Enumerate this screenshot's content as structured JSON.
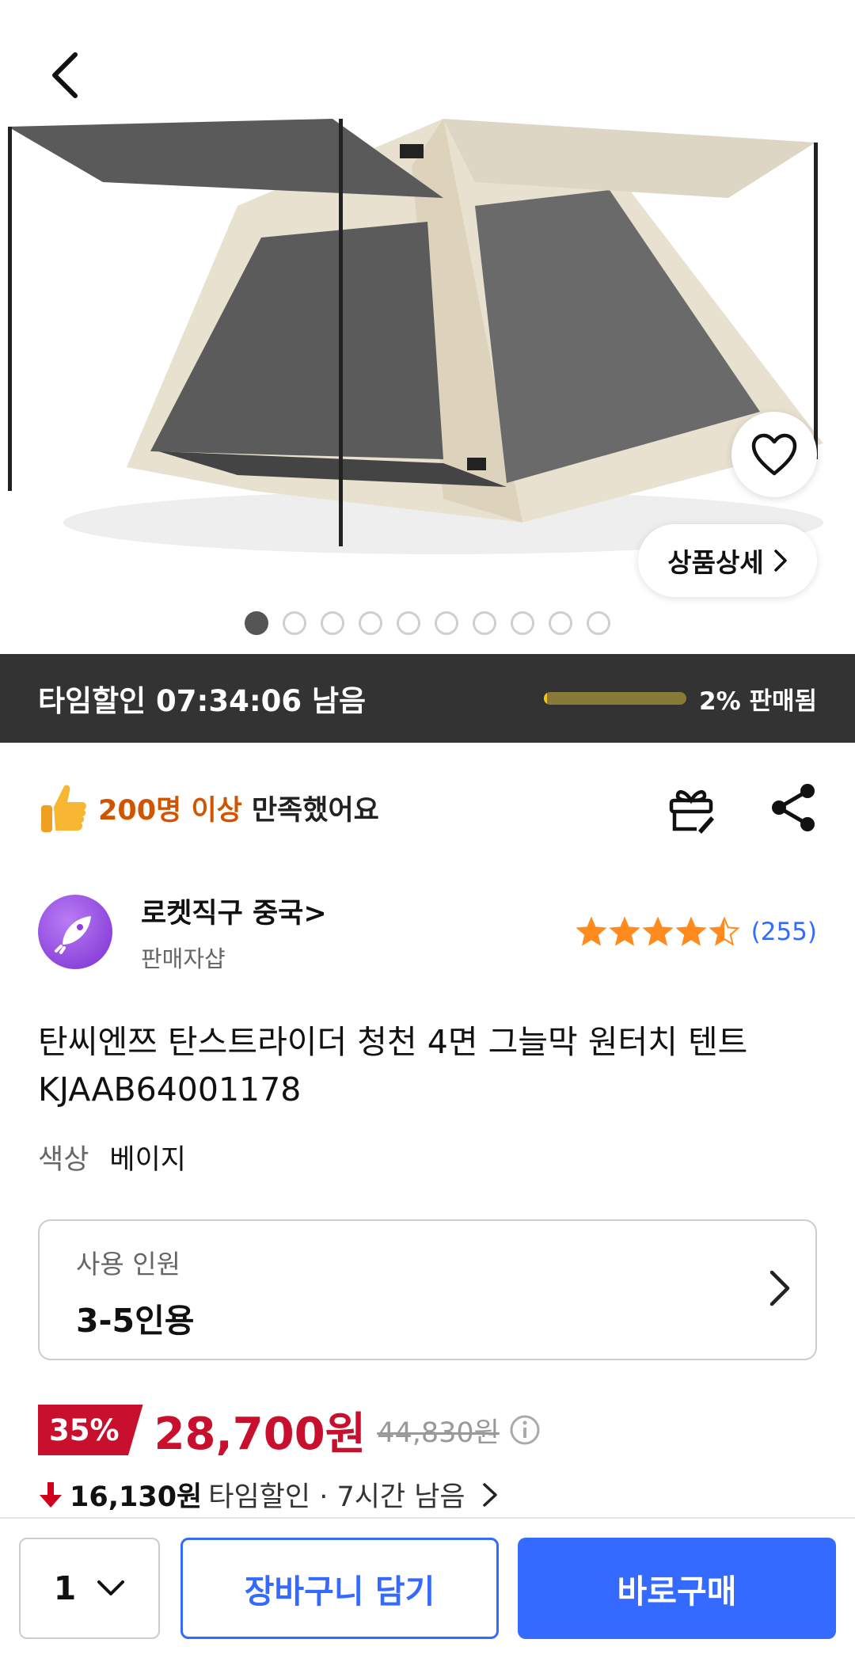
{
  "hero": {
    "image_alt": "",
    "detail_label": "상품상세",
    "dots_total": 10,
    "dots_active": 1
  },
  "time_sale": {
    "label": "타임할인 07:34:06 남음",
    "sold_text": "2% 판매됨",
    "sold_fraction": 0.02
  },
  "satisfaction": {
    "count_text": "200명 이상",
    "text": "만족했어요"
  },
  "seller": {
    "name": "로켓직구 중국>",
    "sub": "판매자샵",
    "rating": 4.5,
    "review_count": "(255)"
  },
  "product": {
    "title": "탄씨엔쯔 탄스트라이더 청천 4면 그늘막 원터치 텐트 KJAAB64001178",
    "color_key": "색상",
    "color_value": "베이지"
  },
  "option": {
    "label": "사용 인원",
    "value": "3-5인용"
  },
  "price": {
    "discount_badge": "35%",
    "sale_price": "28,700원",
    "original_price": "44,830원",
    "discount_amount": "16,130원",
    "discount_text": "타임할인 · 7시간 남음"
  },
  "bottom": {
    "quantity": "1",
    "cart_label": "장바구니 담기",
    "buy_label": "바로구매"
  },
  "colors": {
    "accent": "#346aff",
    "price_red": "#c8102e",
    "satisfaction_orange": "#d35400",
    "timebar_bg": "#333333"
  }
}
